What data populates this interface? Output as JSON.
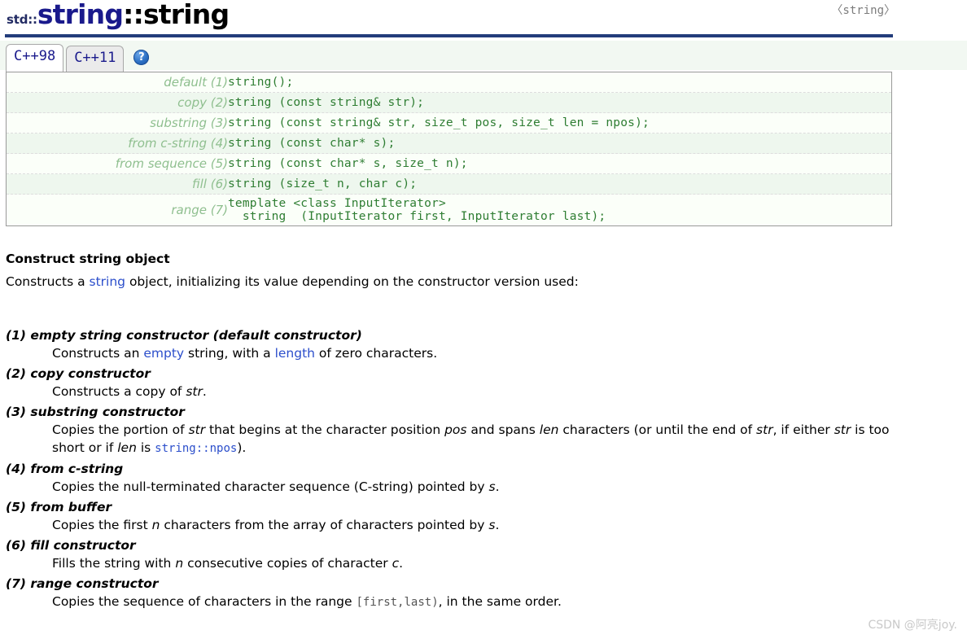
{
  "page": {
    "title_namespace": "std::",
    "title_class": "string",
    "title_separator": "::",
    "title_member": "string",
    "header_file": "〈string〉"
  },
  "tabs": [
    {
      "label": "C++98",
      "active": true
    },
    {
      "label": "C++11",
      "active": false
    }
  ],
  "help": {
    "glyph": "?"
  },
  "signatures": [
    {
      "label": "default (1)",
      "code": "string();"
    },
    {
      "label": "copy (2)",
      "code": "string (const string& str);"
    },
    {
      "label": "substring (3)",
      "code": "string (const string& str, size_t pos, size_t len = npos);"
    },
    {
      "label": "from c-string (4)",
      "code": "string (const char* s);"
    },
    {
      "label": "from sequence (5)",
      "code": "string (const char* s, size_t n);"
    },
    {
      "label": "fill (6)",
      "code": "string (size_t n, char c);"
    },
    {
      "label": "range (7)",
      "code": "template <class InputIterator>\n  string  (InputIterator first, InputIterator last);"
    }
  ],
  "body": {
    "section_title": "Construct string object",
    "intro_before": "Constructs a ",
    "intro_link": "string",
    "intro_after": " object, initializing its value depending on the constructor version used:"
  },
  "constructors": [
    {
      "heading": "(1) empty string constructor (default constructor)",
      "parts": [
        {
          "t": "Constructs an "
        },
        {
          "t": "empty",
          "s": "link"
        },
        {
          "t": " string, with a "
        },
        {
          "t": "length",
          "s": "link"
        },
        {
          "t": " of zero characters."
        }
      ]
    },
    {
      "heading": "(2) copy constructor",
      "parts": [
        {
          "t": "Constructs a copy of "
        },
        {
          "t": "str",
          "s": "italic"
        },
        {
          "t": "."
        }
      ]
    },
    {
      "heading": "(3) substring constructor",
      "parts": [
        {
          "t": "Copies the portion of "
        },
        {
          "t": "str",
          "s": "italic"
        },
        {
          "t": " that begins at the character position "
        },
        {
          "t": "pos",
          "s": "italic"
        },
        {
          "t": " and spans "
        },
        {
          "t": "len",
          "s": "italic"
        },
        {
          "t": " characters (or until the end of "
        },
        {
          "t": "str",
          "s": "italic"
        },
        {
          "t": ", if either "
        },
        {
          "t": "str",
          "s": "italic"
        },
        {
          "t": " is too short or if "
        },
        {
          "t": "len",
          "s": "italic"
        },
        {
          "t": " is "
        },
        {
          "t": "string::npos",
          "s": "mono-link"
        },
        {
          "t": ")."
        }
      ]
    },
    {
      "heading": "(4) from c-string",
      "parts": [
        {
          "t": "Copies the null-terminated character sequence (C-string) pointed by "
        },
        {
          "t": "s",
          "s": "italic"
        },
        {
          "t": "."
        }
      ]
    },
    {
      "heading": "(5) from buffer",
      "parts": [
        {
          "t": "Copies the first "
        },
        {
          "t": "n",
          "s": "italic"
        },
        {
          "t": " characters from the array of characters pointed by "
        },
        {
          "t": "s",
          "s": "italic"
        },
        {
          "t": "."
        }
      ]
    },
    {
      "heading": "(6) fill constructor",
      "parts": [
        {
          "t": "Fills the string with "
        },
        {
          "t": "n",
          "s": "italic"
        },
        {
          "t": " consecutive copies of character "
        },
        {
          "t": "c",
          "s": "italic"
        },
        {
          "t": "."
        }
      ]
    },
    {
      "heading": "(7) range constructor",
      "parts": [
        {
          "t": "Copies the sequence of characters in the range "
        },
        {
          "t": "[first,last)",
          "s": "mono-gray"
        },
        {
          "t": ", in the same order."
        }
      ]
    }
  ],
  "watermark": "CSDN @阿亮joy.",
  "colors": {
    "rule": "#233d7b",
    "title_class": "#1a1a8c",
    "link": "#2b4ecb",
    "sig_code": "#2e7d32",
    "sig_label": "#8fbf8f",
    "panel_bg": "#fbfff9",
    "tabstrip_bg": "#f2f8f2"
  }
}
